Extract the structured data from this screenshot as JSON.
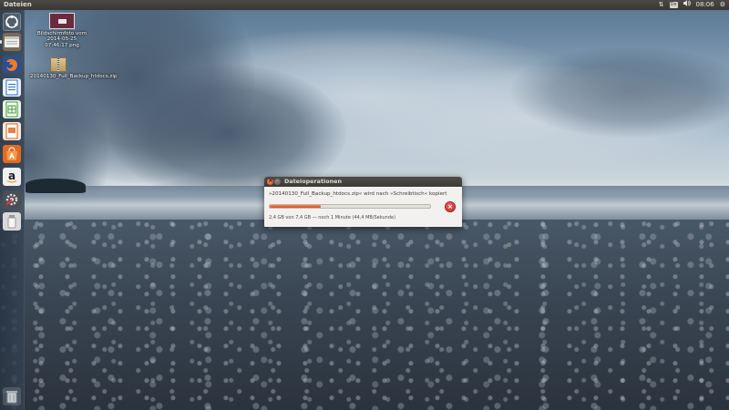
{
  "panel": {
    "app_title": "Dateien",
    "indicators": [
      "network-transfer-icon",
      "keyboard-layout-icon",
      "volume-icon",
      "clock",
      "gear-icon"
    ],
    "keyboard_label": "De",
    "clock": "08:06"
  },
  "launcher": {
    "items": [
      {
        "name": "dash-icon",
        "label": "Dash"
      },
      {
        "name": "files-icon",
        "label": "Dateien",
        "running": true
      },
      {
        "name": "firefox-icon",
        "label": "Firefox"
      },
      {
        "name": "writer-icon",
        "label": "LibreOffice Writer"
      },
      {
        "name": "calc-icon",
        "label": "LibreOffice Calc"
      },
      {
        "name": "impress-icon",
        "label": "LibreOffice Impress"
      },
      {
        "name": "software-center-icon",
        "label": "Ubuntu Software Center"
      },
      {
        "name": "amazon-icon",
        "label": "Amazon"
      },
      {
        "name": "system-settings-icon",
        "label": "Systemeinstellungen"
      },
      {
        "name": "usb-drive-icon",
        "label": "Datenträger"
      },
      {
        "name": "trash-icon",
        "label": "Papierkorb"
      }
    ]
  },
  "desktop": {
    "icons": [
      {
        "name": "screenshot-file-icon",
        "label": "Bildschirmfoto vom 2014-05-25 07:46:17.png"
      },
      {
        "name": "zip-archive-icon",
        "label": "20140130_Full_Backup_htdocs.zip"
      }
    ]
  },
  "dialog": {
    "title": "Dateioperationen",
    "operation": "»20140130_Full_Backup_htdocs.zip« wird nach »Schreibtisch« kopiert",
    "progress": 0.32,
    "status": "2,4 GB von 7,4 GB — noch 1 Minute (44,4 MB/Sekunde)",
    "colors": {
      "progress": "#dd4814",
      "cancel": "#c41c1c"
    }
  }
}
